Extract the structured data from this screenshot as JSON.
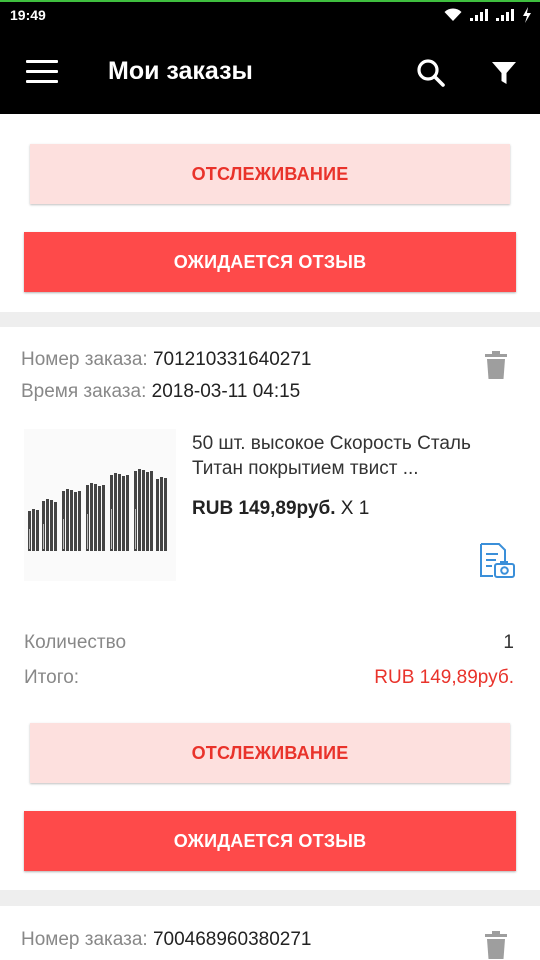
{
  "status": {
    "time": "19:49"
  },
  "toolbar": {
    "title": "Мои заказы",
    "accent": "#000000"
  },
  "colors": {
    "primary_red": "#fe4a4a",
    "light_red": "#fde0de",
    "price_red": "#e9332b"
  },
  "actions": {
    "tracking_label": "ОТСЛЕЖИВАНИЕ",
    "review_label": "ОЖИДАЕТСЯ ОТЗЫВ"
  },
  "orders": [
    {
      "number_label": "Номер заказа:",
      "number": "701210331640271",
      "time_label": "Время заказа:",
      "time": "2018-03-11 04:15",
      "product_title": "50 шт. высокое Скорость Сталь Титан покрытием твист ...",
      "price": "RUB 149,89руб.",
      "qty_suffix": "X 1",
      "quantity_label": "Количество",
      "quantity": "1",
      "total_label": "Итого:",
      "total": "RUB 149,89руб."
    },
    {
      "number_label": "Номер заказа:",
      "number": "700468960380271"
    }
  ]
}
